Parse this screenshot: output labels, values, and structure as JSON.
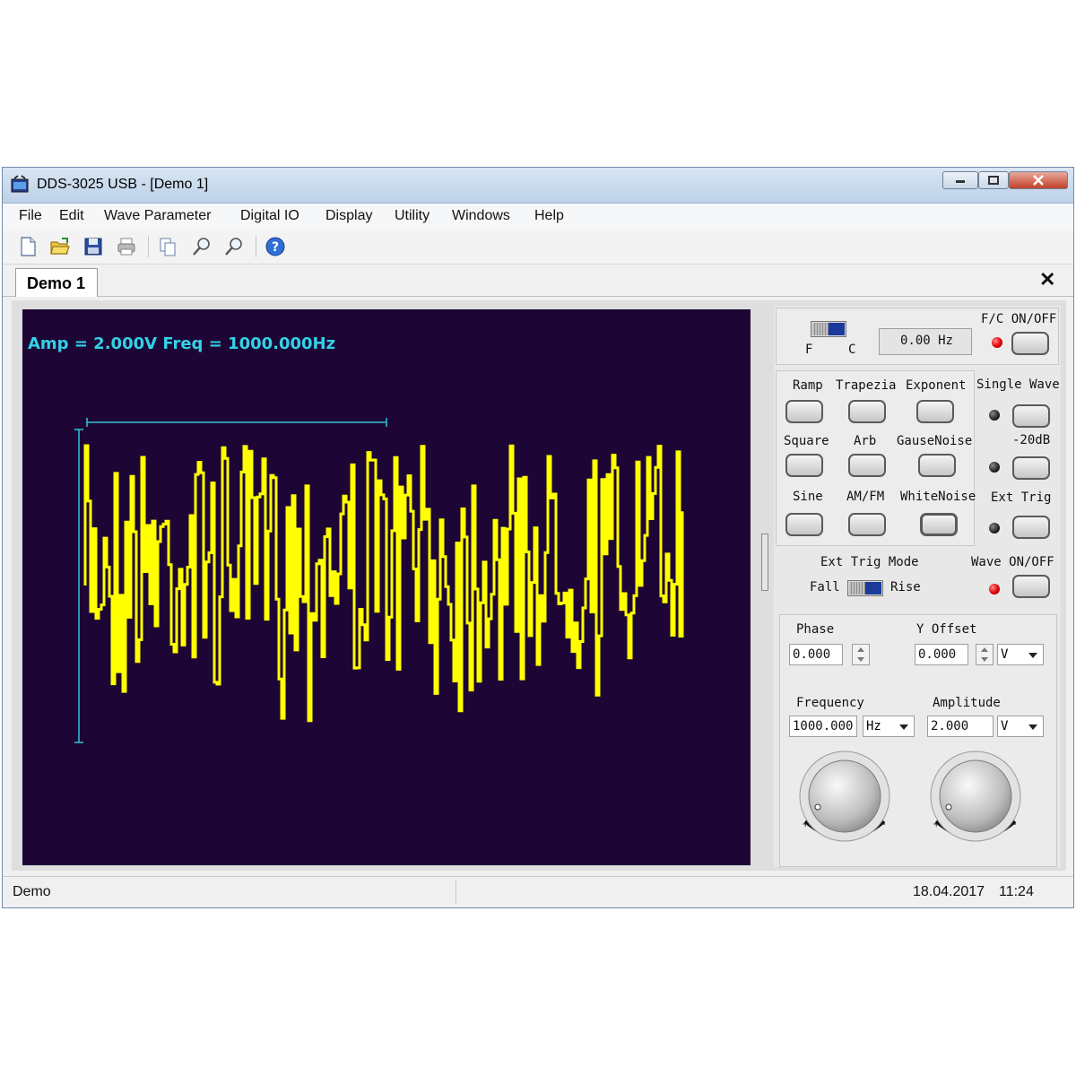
{
  "window": {
    "title": "DDS-3025 USB - [Demo 1]"
  },
  "menu": [
    "File",
    "Edit",
    "Wave Parameter",
    "Digital IO",
    "Display",
    "Utility",
    "Windows",
    "Help"
  ],
  "toolbar": {
    "icons": [
      "new-file-icon",
      "open-folder-icon",
      "save-icon",
      "print-icon",
      "copy-icon",
      "zoom-in-icon",
      "zoom-out-icon",
      "help-icon"
    ]
  },
  "tab": {
    "label": "Demo 1"
  },
  "scope": {
    "readout": "Amp = 2.000V  Freq = 1000.000Hz",
    "trace_color": "#ffff00",
    "background": "#1d0635"
  },
  "fc": {
    "f_label": "F",
    "c_label": "C",
    "display": "0.00 Hz",
    "onoff_label": "F/C ON/OFF"
  },
  "waves": {
    "ramp": "Ramp",
    "trapezia": "Trapezia",
    "exponent": "Exponent",
    "square": "Square",
    "arb": "Arb",
    "gausenoise": "GauseNoise",
    "sine": "Sine",
    "amfm": "AM/FM",
    "whitenoise": "WhiteNoise"
  },
  "options": {
    "single_wave": "Single Wave",
    "minus20db": "-20dB",
    "ext_trig": "Ext Trig"
  },
  "trig": {
    "mode_label": "Ext Trig Mode",
    "fall": "Fall",
    "rise": "Rise",
    "wave_onoff": "Wave ON/OFF"
  },
  "params": {
    "phase_label": "Phase",
    "phase_value": "0.000",
    "yoffset_label": "Y Offset",
    "yoffset_value": "0.000",
    "yoffset_unit": "V",
    "frequency_label": "Frequency",
    "frequency_value": "1000.000",
    "frequency_unit": "Hz",
    "amplitude_label": "Amplitude",
    "amplitude_value": "2.000",
    "amplitude_unit": "V"
  },
  "knobs": {
    "plus": "+",
    "minus": "-"
  },
  "status": {
    "text": "Demo",
    "date": "18.04.2017",
    "time": "11:24"
  },
  "colors": {
    "accent": "#1b3a9c",
    "led_on": "#e00000",
    "readout": "#33d1e8"
  }
}
